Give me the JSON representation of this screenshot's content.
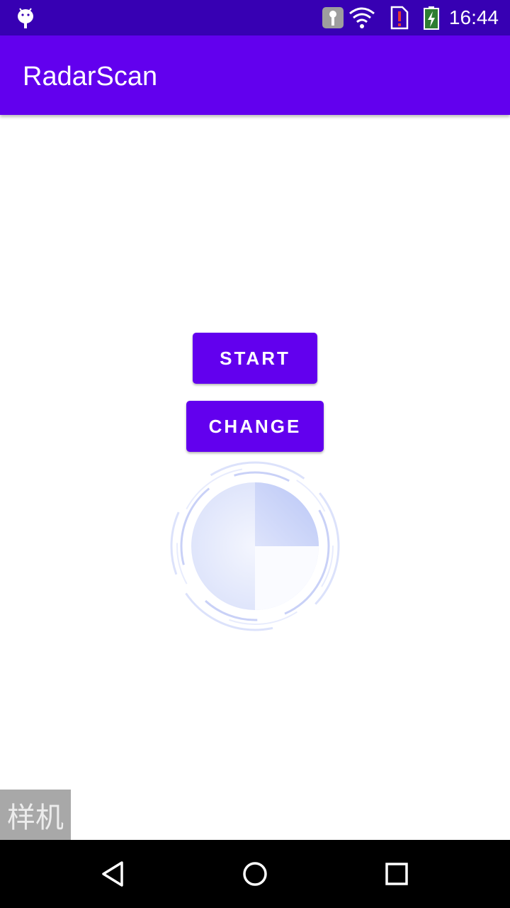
{
  "status_bar": {
    "time": "16:44",
    "icons": [
      "android-icon",
      "vpn-key-icon",
      "wifi-icon",
      "no-sim-icon",
      "battery-charging-icon"
    ]
  },
  "app_bar": {
    "title": "RadarScan"
  },
  "buttons": {
    "start_label": "START",
    "change_label": "CHANGE"
  },
  "radar": {
    "icon": "radar-scan-icon",
    "accent": "#6b7ff0"
  },
  "watermark": {
    "text": "样机"
  },
  "nav_bar": {
    "icons": [
      "back-icon",
      "home-icon",
      "recents-icon"
    ]
  },
  "colors": {
    "primary": "#6200ee",
    "primary_dark": "#3700b3"
  }
}
